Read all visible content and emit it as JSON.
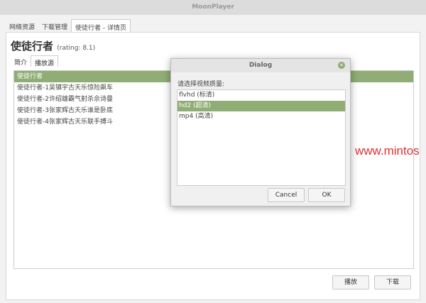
{
  "window_title": "MoonPlayer",
  "tabs": [
    "网络资源",
    "下载管理",
    "使徒行者 - 详情页"
  ],
  "title": "使徒行者",
  "rating": "(rating: 8.1)",
  "subtabs": [
    "简介",
    "播放源"
  ],
  "sources": [
    "使徒行者",
    "使徒行者-1吴镇宇古天乐惊险飙车",
    "使徒行者-2许绍雄霸气射杀佘诗曼",
    "使徒行者-3张家辉古天乐谁是卧底",
    "使徒行者-4张家辉古天乐联手搏斗"
  ],
  "play_label": "播放",
  "download_label": "下载",
  "watermark": "www.mintos",
  "dialog": {
    "title": "Dialog",
    "prompt": "请选择视频质量:",
    "options": [
      "flvhd (标清)",
      "hd2 (超清)",
      "mp4 (高清)"
    ],
    "selected": 1,
    "cancel_label": "Cancel",
    "ok_label": "OK"
  },
  "accent": "#8fad74"
}
